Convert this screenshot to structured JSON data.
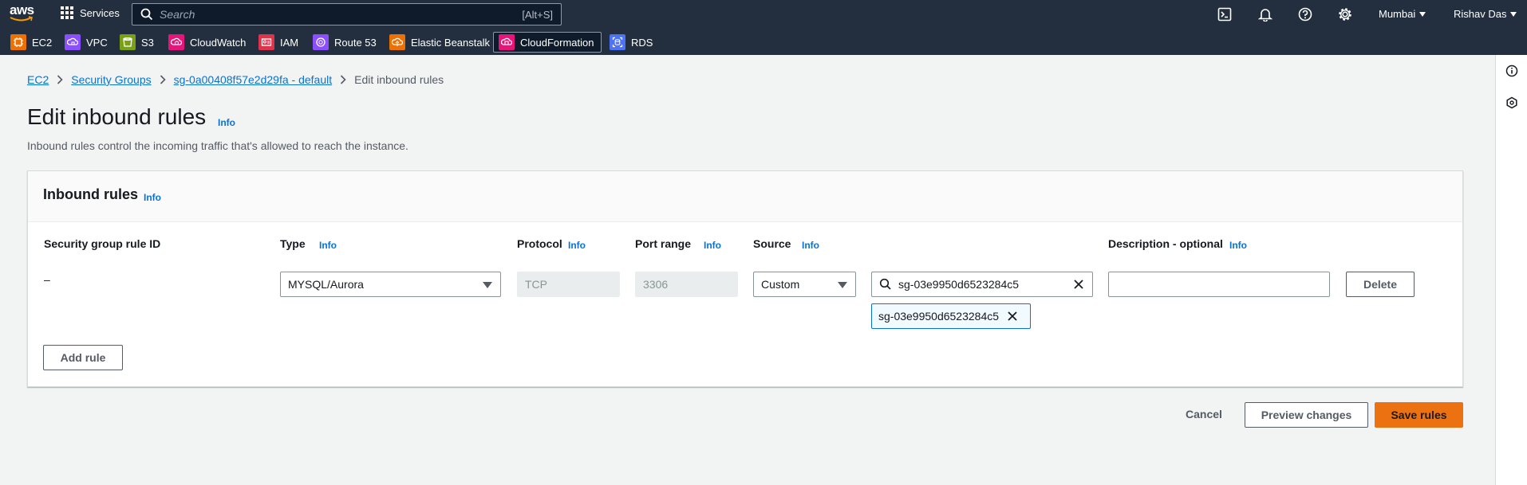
{
  "topbar": {
    "logo_text": "aws",
    "services_label": "Services",
    "search_placeholder": "Search",
    "search_shortcut": "[Alt+S]",
    "region": "Mumbai",
    "user": "Rishav Das",
    "icons": [
      "cloudshell-icon",
      "bell-icon",
      "help-icon",
      "gear-icon"
    ]
  },
  "bookmarks": [
    {
      "label": "EC2",
      "color": "#ed7100",
      "icon": "ec2-icon"
    },
    {
      "label": "VPC",
      "color": "#8c4fff",
      "icon": "vpc-icon"
    },
    {
      "label": "S3",
      "color": "#7aa116",
      "icon": "s3-icon"
    },
    {
      "label": "CloudWatch",
      "color": "#e7157b",
      "icon": "cloudwatch-icon"
    },
    {
      "label": "IAM",
      "color": "#dd344c",
      "icon": "iam-icon"
    },
    {
      "label": "Route 53",
      "color": "#8c4fff",
      "icon": "route53-icon"
    },
    {
      "label": "Elastic Beanstalk",
      "color": "#ed7100",
      "icon": "beanstalk-icon"
    },
    {
      "label": "CloudFormation",
      "color": "#e7157b",
      "icon": "cloudformation-icon"
    },
    {
      "label": "RDS",
      "color": "#4d72f3",
      "icon": "rds-icon"
    }
  ],
  "breadcrumb": {
    "items": [
      "EC2",
      "Security Groups",
      "sg-0a00408f57e2d29fa - default"
    ],
    "current": "Edit inbound rules"
  },
  "page": {
    "title": "Edit inbound rules",
    "info": "Info",
    "description": "Inbound rules control the incoming traffic that's allowed to reach the instance."
  },
  "panel": {
    "title": "Inbound rules",
    "info": "Info",
    "columns": {
      "rule_id": "Security group rule ID",
      "type": "Type",
      "protocol": "Protocol",
      "port_range": "Port range",
      "source": "Source",
      "description": "Description - optional"
    },
    "info_label": "Info",
    "row": {
      "rule_id": "–",
      "type": "MYSQL/Aurora",
      "protocol": "TCP",
      "port_range": "3306",
      "source_type": "Custom",
      "source_value": "sg-03e9950d6523284c5",
      "source_token": "sg-03e9950d6523284c5",
      "description_value": "",
      "delete_label": "Delete"
    },
    "add_rule_label": "Add rule"
  },
  "actions": {
    "cancel": "Cancel",
    "preview": "Preview changes",
    "save": "Save rules"
  }
}
